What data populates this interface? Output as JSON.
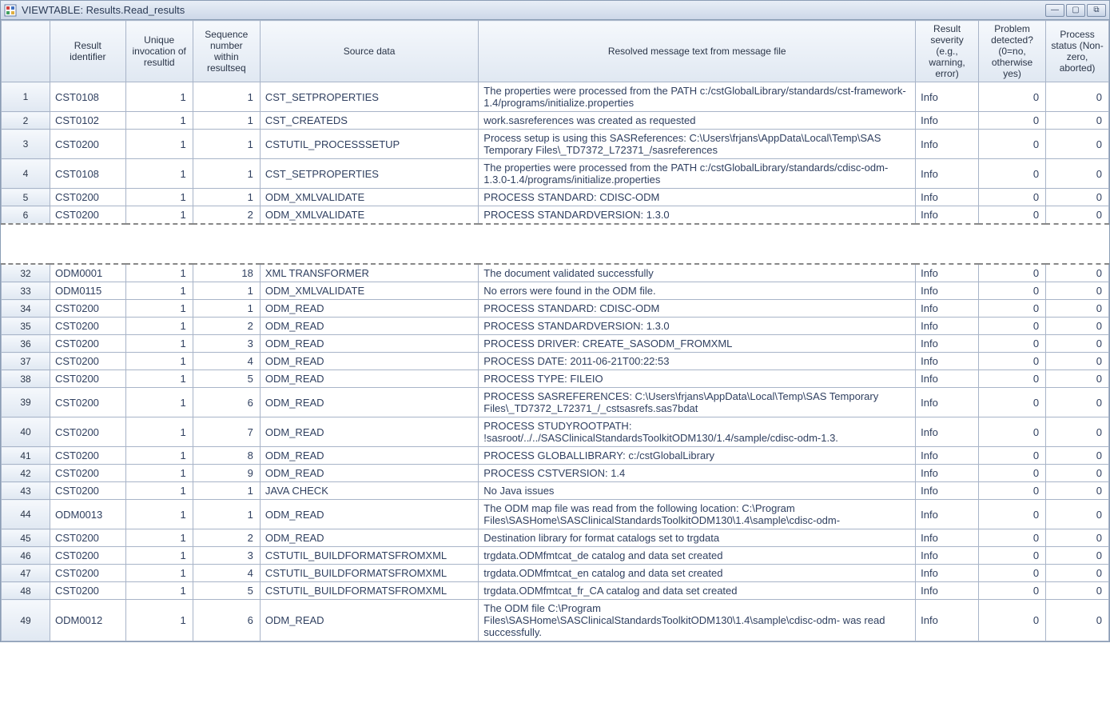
{
  "window": {
    "title": "VIEWTABLE: Results.Read_results"
  },
  "columns": [
    "",
    "Result identifier",
    "Unique invocation of resultid",
    "Sequence number within resultseq",
    "Source data",
    "Resolved message text from message file",
    "Result severity (e.g., warning, error)",
    "Problem detected? (0=no, otherwise yes)",
    "Process status (Non-zero, aborted)"
  ],
  "rows_top": [
    {
      "n": "1",
      "id": "CST0108",
      "inv": "1",
      "seq": "1",
      "src": "CST_SETPROPERTIES",
      "msg": "The properties were processed from the PATH c:/cstGlobalLibrary/standards/cst-framework-1.4/programs/initialize.properties",
      "sev": "Info",
      "prob": "0",
      "stat": "0"
    },
    {
      "n": "2",
      "id": "CST0102",
      "inv": "1",
      "seq": "1",
      "src": "CST_CREATEDS",
      "msg": "work.sasreferences was created as requested",
      "sev": "Info",
      "prob": "0",
      "stat": "0"
    },
    {
      "n": "3",
      "id": "CST0200",
      "inv": "1",
      "seq": "1",
      "src": "CSTUTIL_PROCESSSETUP",
      "msg": "Process setup is using this SASReferences: C:\\Users\\frjans\\AppData\\Local\\Temp\\SAS Temporary Files\\_TD7372_L72371_/sasreferences",
      "sev": "Info",
      "prob": "0",
      "stat": "0"
    },
    {
      "n": "4",
      "id": "CST0108",
      "inv": "1",
      "seq": "1",
      "src": "CST_SETPROPERTIES",
      "msg": "The properties were processed from the PATH c:/cstGlobalLibrary/standards/cdisc-odm-1.3.0-1.4/programs/initialize.properties",
      "sev": "Info",
      "prob": "0",
      "stat": "0"
    },
    {
      "n": "5",
      "id": "CST0200",
      "inv": "1",
      "seq": "1",
      "src": "ODM_XMLVALIDATE",
      "msg": "PROCESS STANDARD: CDISC-ODM",
      "sev": "Info",
      "prob": "0",
      "stat": "0"
    },
    {
      "n": "6",
      "id": "CST0200",
      "inv": "1",
      "seq": "2",
      "src": "ODM_XMLVALIDATE",
      "msg": "PROCESS STANDARDVERSION: 1.3.0",
      "sev": "Info",
      "prob": "0",
      "stat": "0"
    }
  ],
  "rows_bottom": [
    {
      "n": "32",
      "id": "ODM0001",
      "inv": "1",
      "seq": "18",
      "src": "XML TRANSFORMER",
      "msg": "The document validated successfully",
      "sev": "Info",
      "prob": "0",
      "stat": "0"
    },
    {
      "n": "33",
      "id": "ODM0115",
      "inv": "1",
      "seq": "1",
      "src": "ODM_XMLVALIDATE",
      "msg": "No errors were found in the ODM file.",
      "sev": "Info",
      "prob": "0",
      "stat": "0"
    },
    {
      "n": "34",
      "id": "CST0200",
      "inv": "1",
      "seq": "1",
      "src": "ODM_READ",
      "msg": "PROCESS STANDARD: CDISC-ODM",
      "sev": "Info",
      "prob": "0",
      "stat": "0"
    },
    {
      "n": "35",
      "id": "CST0200",
      "inv": "1",
      "seq": "2",
      "src": "ODM_READ",
      "msg": "PROCESS STANDARDVERSION: 1.3.0",
      "sev": "Info",
      "prob": "0",
      "stat": "0"
    },
    {
      "n": "36",
      "id": "CST0200",
      "inv": "1",
      "seq": "3",
      "src": "ODM_READ",
      "msg": "PROCESS DRIVER: CREATE_SASODM_FROMXML",
      "sev": "Info",
      "prob": "0",
      "stat": "0"
    },
    {
      "n": "37",
      "id": "CST0200",
      "inv": "1",
      "seq": "4",
      "src": "ODM_READ",
      "msg": "PROCESS DATE: 2011-06-21T00:22:53",
      "sev": "Info",
      "prob": "0",
      "stat": "0"
    },
    {
      "n": "38",
      "id": "CST0200",
      "inv": "1",
      "seq": "5",
      "src": "ODM_READ",
      "msg": "PROCESS TYPE: FILEIO",
      "sev": "Info",
      "prob": "0",
      "stat": "0"
    },
    {
      "n": "39",
      "id": "CST0200",
      "inv": "1",
      "seq": "6",
      "src": "ODM_READ",
      "msg": "PROCESS SASREFERENCES: C:\\Users\\frjans\\AppData\\Local\\Temp\\SAS Temporary Files\\_TD7372_L72371_/_cstsasrefs.sas7bdat",
      "sev": "Info",
      "prob": "0",
      "stat": "0"
    },
    {
      "n": "40",
      "id": "CST0200",
      "inv": "1",
      "seq": "7",
      "src": "ODM_READ",
      "msg": "PROCESS STUDYROOTPATH: !sasroot/../../SASClinicalStandardsToolkitODM130/1.4/sample/cdisc-odm-1.3.",
      "sev": "Info",
      "prob": "0",
      "stat": "0"
    },
    {
      "n": "41",
      "id": "CST0200",
      "inv": "1",
      "seq": "8",
      "src": "ODM_READ",
      "msg": "PROCESS GLOBALLIBRARY: c:/cstGlobalLibrary",
      "sev": "Info",
      "prob": "0",
      "stat": "0"
    },
    {
      "n": "42",
      "id": "CST0200",
      "inv": "1",
      "seq": "9",
      "src": "ODM_READ",
      "msg": "PROCESS CSTVERSION: 1.4",
      "sev": "Info",
      "prob": "0",
      "stat": "0"
    },
    {
      "n": "43",
      "id": "CST0200",
      "inv": "1",
      "seq": "1",
      "src": "JAVA CHECK",
      "msg": "No Java issues",
      "sev": "Info",
      "prob": "0",
      "stat": "0"
    },
    {
      "n": "44",
      "id": "ODM0013",
      "inv": "1",
      "seq": "1",
      "src": "ODM_READ",
      "msg": "The ODM map file was read from the following location: C:\\Program Files\\SASHome\\SASClinicalStandardsToolkitODM130\\1.4\\sample\\cdisc-odm-",
      "sev": "Info",
      "prob": "0",
      "stat": "0"
    },
    {
      "n": "45",
      "id": "CST0200",
      "inv": "1",
      "seq": "2",
      "src": "ODM_READ",
      "msg": "Destination library for format catalogs set to trgdata",
      "sev": "Info",
      "prob": "0",
      "stat": "0"
    },
    {
      "n": "46",
      "id": "CST0200",
      "inv": "1",
      "seq": "3",
      "src": "CSTUTIL_BUILDFORMATSFROMXML",
      "msg": "trgdata.ODMfmtcat_de catalog and data set created",
      "sev": "Info",
      "prob": "0",
      "stat": "0"
    },
    {
      "n": "47",
      "id": "CST0200",
      "inv": "1",
      "seq": "4",
      "src": "CSTUTIL_BUILDFORMATSFROMXML",
      "msg": "trgdata.ODMfmtcat_en catalog and data set created",
      "sev": "Info",
      "prob": "0",
      "stat": "0"
    },
    {
      "n": "48",
      "id": "CST0200",
      "inv": "1",
      "seq": "5",
      "src": "CSTUTIL_BUILDFORMATSFROMXML",
      "msg": "trgdata.ODMfmtcat_fr_CA catalog and data set created",
      "sev": "Info",
      "prob": "0",
      "stat": "0"
    },
    {
      "n": "49",
      "id": "ODM0012",
      "inv": "1",
      "seq": "6",
      "src": "ODM_READ",
      "msg": "The ODM file C:\\Program Files\\SASHome\\SASClinicalStandardsToolkitODM130\\1.4\\sample\\cdisc-odm- was read successfully.",
      "sev": "Info",
      "prob": "0",
      "stat": "0"
    }
  ]
}
